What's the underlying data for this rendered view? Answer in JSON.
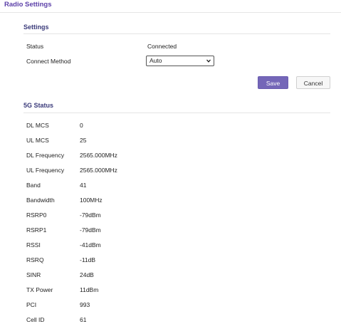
{
  "page_title": "Radio Settings",
  "settings": {
    "title": "Settings",
    "status_label": "Status",
    "status_value": "Connected",
    "connect_method_label": "Connect Method",
    "connect_method_value": "Auto",
    "save_label": "Save",
    "cancel_label": "Cancel"
  },
  "status5g": {
    "title": "5G Status",
    "rows": [
      {
        "label": "DL MCS",
        "value": "0"
      },
      {
        "label": "UL MCS",
        "value": "25"
      },
      {
        "label": "DL Frequency",
        "value": "2565.000MHz"
      },
      {
        "label": "UL Frequency",
        "value": "2565.000MHz"
      },
      {
        "label": "Band",
        "value": "41"
      },
      {
        "label": "Bandwidth",
        "value": "100MHz"
      },
      {
        "label": "RSRP0",
        "value": "-79dBm"
      },
      {
        "label": "RSRP1",
        "value": "-79dBm"
      },
      {
        "label": "RSSI",
        "value": "-41dBm"
      },
      {
        "label": "RSRQ",
        "value": "-11dB"
      },
      {
        "label": "SINR",
        "value": "24dB"
      },
      {
        "label": "TX Power",
        "value": "11dBm"
      },
      {
        "label": "PCI",
        "value": "993"
      },
      {
        "label": "Cell ID",
        "value": "61"
      }
    ]
  }
}
